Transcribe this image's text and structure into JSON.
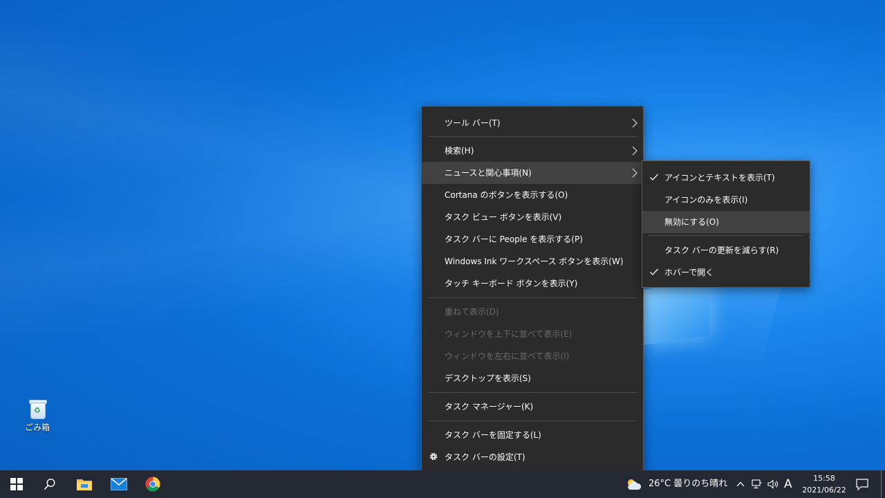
{
  "desktop": {
    "recycle_bin_label": "ごみ箱"
  },
  "context_menu": {
    "toolbars": "ツール バー(T)",
    "search": "検索(H)",
    "news_interests": "ニュースと関心事項(N)",
    "show_cortana": "Cortana のボタンを表示する(O)",
    "show_task_view": "タスク ビュー ボタンを表示(V)",
    "show_people": "タスク バーに People を表示する(P)",
    "show_ink": "Windows Ink ワークスペース ボタンを表示(W)",
    "show_touch_keyboard": "タッチ キーボード ボタンを表示(Y)",
    "cascade": "重ねて表示(D)",
    "stack": "ウィンドウを上下に並べて表示(E)",
    "side_by_side": "ウィンドウを左右に並べて表示(I)",
    "show_desktop": "デスクトップを表示(S)",
    "task_manager": "タスク マネージャー(K)",
    "lock_taskbar": "タスク バーを固定する(L)",
    "taskbar_settings": "タスク バーの設定(T)"
  },
  "submenu": {
    "icon_and_text": "アイコンとテキストを表示(T)",
    "icon_only": "アイコンのみを表示(I)",
    "turn_off": "無効にする(O)",
    "reduce_updates": "タスク バーの更新を減らす(R)",
    "open_on_hover": "ホバーで開く",
    "checked": [
      "icon_and_text",
      "open_on_hover"
    ]
  },
  "taskbar": {
    "weather": "26°C 曇りのち晴れ",
    "ime_mode": "A",
    "time": "15:58",
    "date": "2021/06/22"
  },
  "colors": {
    "menu_bg": "#2b2b2b",
    "menu_hover": "#414141",
    "disabled_text": "#6b6b6b",
    "taskbar_bg": "#232833"
  }
}
